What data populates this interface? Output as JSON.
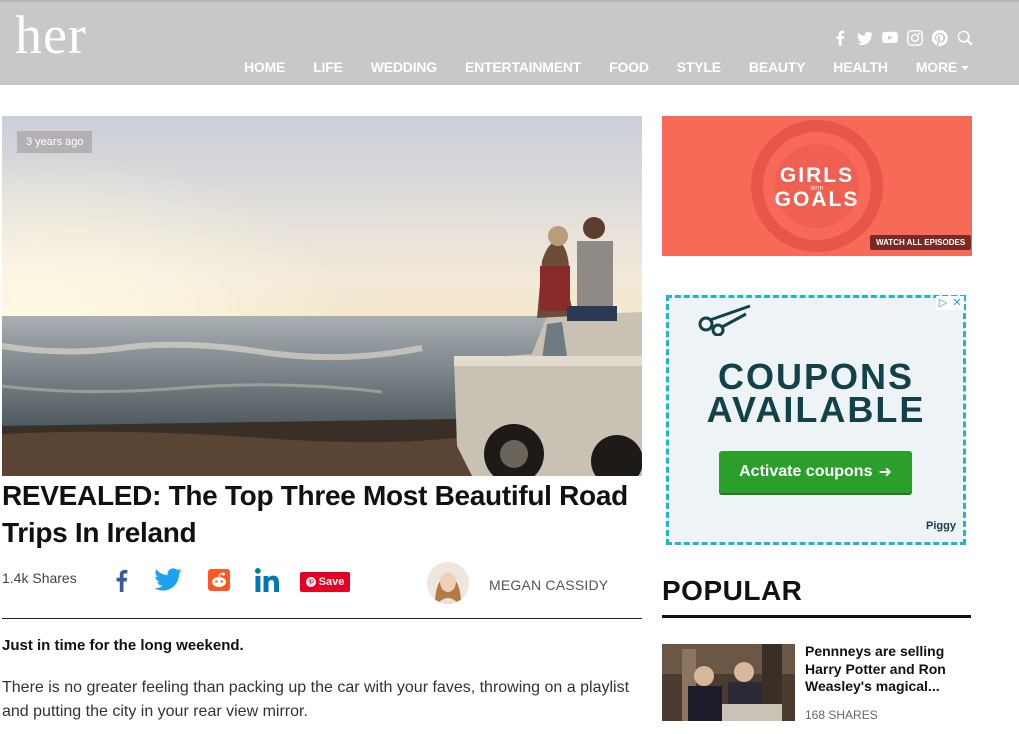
{
  "site": {
    "logo": "her"
  },
  "nav": {
    "items": [
      "HOME",
      "LIFE",
      "WEDDING",
      "ENTERTAINMENT",
      "FOOD",
      "STYLE",
      "BEAUTY",
      "HEALTH"
    ],
    "more": "MORE"
  },
  "social_icons": [
    "facebook-icon",
    "twitter-icon",
    "youtube-icon",
    "instagram-icon",
    "pinterest-icon",
    "search-icon"
  ],
  "article": {
    "age": "3 years ago",
    "title": "REVEALED: The Top Three Most Beautiful Road Trips In Ireland",
    "shares": "1.4k Shares",
    "save_label": "Save",
    "author": "MEGAN CASSIDY",
    "lead": "Just in time for the long weekend.",
    "body": "There is no greater feeling than packing up the car with your faves, throwing on a playlist and putting the city in your rear view mirror."
  },
  "ad_goals": {
    "line1": "GIRLS",
    "with": "WITH",
    "line2": "GOALS",
    "cta": "WATCH ALL EPISODES"
  },
  "ad_coupons": {
    "line1": "COUPONS",
    "line2": "AVAILABLE",
    "cta": "Activate coupons",
    "brand": "Piggy"
  },
  "popular": {
    "heading": "POPULAR",
    "items": [
      {
        "title": "Pennneys are selling Harry Potter and Ron Weasley's magical...",
        "shares": "168 SHARES"
      }
    ]
  },
  "colors": {
    "header_bg": "#c8c8ca",
    "goals_ad": "#f76a58",
    "coupon_border": "#1fb7c7",
    "activate_green": "#2a9f2a",
    "pinterest_red": "#e60023"
  }
}
